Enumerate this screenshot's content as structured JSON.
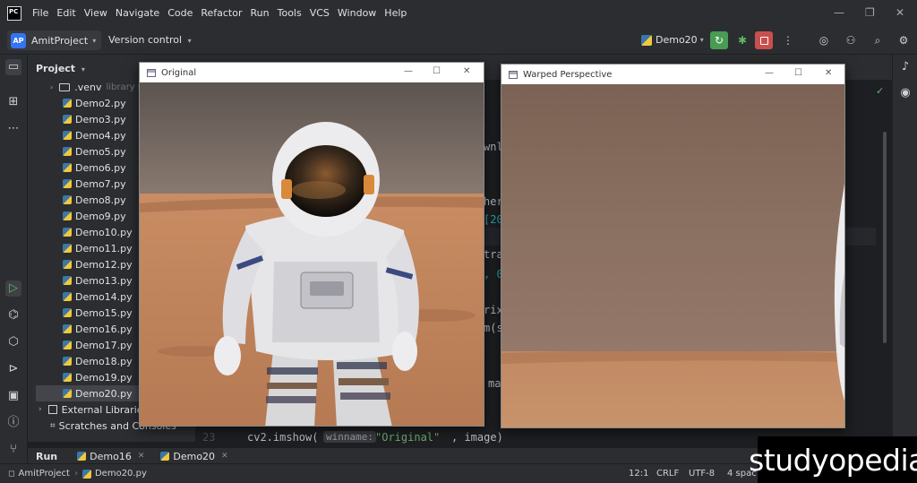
{
  "menu": [
    "File",
    "Edit",
    "View",
    "Navigate",
    "Code",
    "Refactor",
    "Run",
    "Tools",
    "VCS",
    "Window",
    "Help"
  ],
  "app_icon_text": "PC",
  "toolbar": {
    "project_badge": "AP",
    "project_name": "AmitProject",
    "version_control": "Version control",
    "run_config": "Demo20",
    "accent_run": "#499c54",
    "accent_stop": "#c94f4f"
  },
  "project_panel": {
    "title": "Project",
    "venv": ".venv",
    "venv_note": "library ro",
    "files": [
      "Demo2.py",
      "Demo3.py",
      "Demo4.py",
      "Demo5.py",
      "Demo6.py",
      "Demo7.py",
      "Demo8.py",
      "Demo9.py",
      "Demo10.py",
      "Demo11.py",
      "Demo12.py",
      "Demo13.py",
      "Demo14.py",
      "Demo15.py",
      "Demo16.py",
      "Demo17.py",
      "Demo18.py",
      "Demo19.py",
      "Demo20.py"
    ],
    "selected_file": "Demo20.py",
    "external_libraries": "External Libraries",
    "scratches": "Scratches and Consoles"
  },
  "editor": {
    "fragments": [
      "wnl",
      "her",
      "[20",
      "tra",
      ", 0",
      "rix",
      "m(s",
      "ma"
    ],
    "line_number": "23",
    "code_call": "cv2.imshow(",
    "param_hint": "winname:",
    "string_arg": "\"Original\"",
    "code_tail": ", image)"
  },
  "windows": {
    "original_title": "Original",
    "warped_title": "Warped Perspective",
    "ctrl_min": "—",
    "ctrl_max": "☐",
    "ctrl_close": "✕"
  },
  "run_bar": {
    "run_label": "Run",
    "tabs": [
      "Demo16",
      "Demo20"
    ]
  },
  "status": {
    "project": "AmitProject",
    "file": "Demo20.py",
    "position": "12:1",
    "line_sep": "CRLF",
    "encoding": "UTF-8",
    "indent": "4 spac"
  },
  "watermark": "studyopedia"
}
